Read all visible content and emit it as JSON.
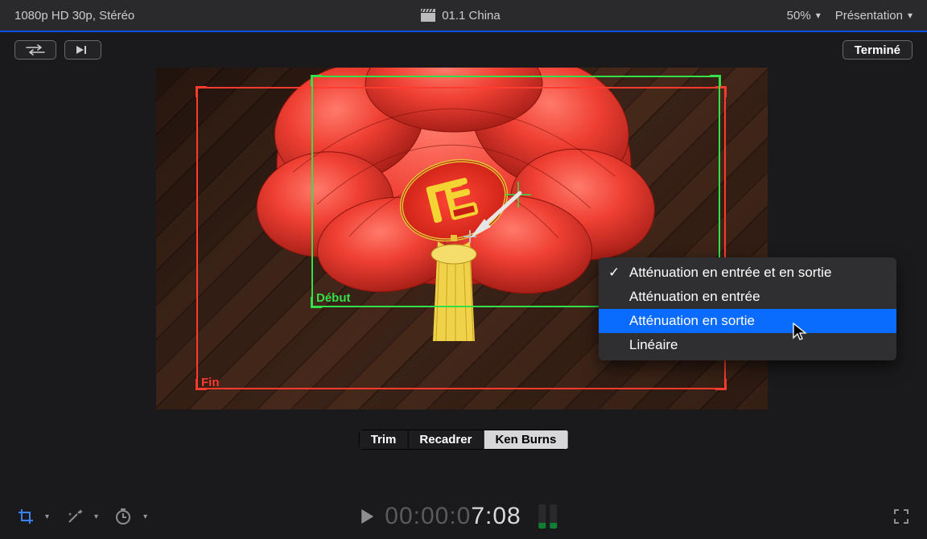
{
  "header": {
    "format": "1080p HD 30p, Stéréo",
    "project": "01.1 China",
    "zoom": "50%",
    "presentation": "Présentation"
  },
  "toolbar": {
    "done": "Terminé"
  },
  "kenburns": {
    "start_label": "Début",
    "end_label": "Fin"
  },
  "context_menu": {
    "items": [
      {
        "label": "Atténuation en entrée et en sortie",
        "checked": true,
        "hover": false
      },
      {
        "label": "Atténuation en entrée",
        "checked": false,
        "hover": false
      },
      {
        "label": "Atténuation en sortie",
        "checked": false,
        "hover": true
      },
      {
        "label": "Linéaire",
        "checked": false,
        "hover": false
      }
    ]
  },
  "mode_tabs": {
    "trim": "Trim",
    "crop": "Recadrer",
    "kenburns": "Ken Burns"
  },
  "status": {
    "timecode_dim": "00:00:0",
    "timecode_lit": "7:08"
  }
}
